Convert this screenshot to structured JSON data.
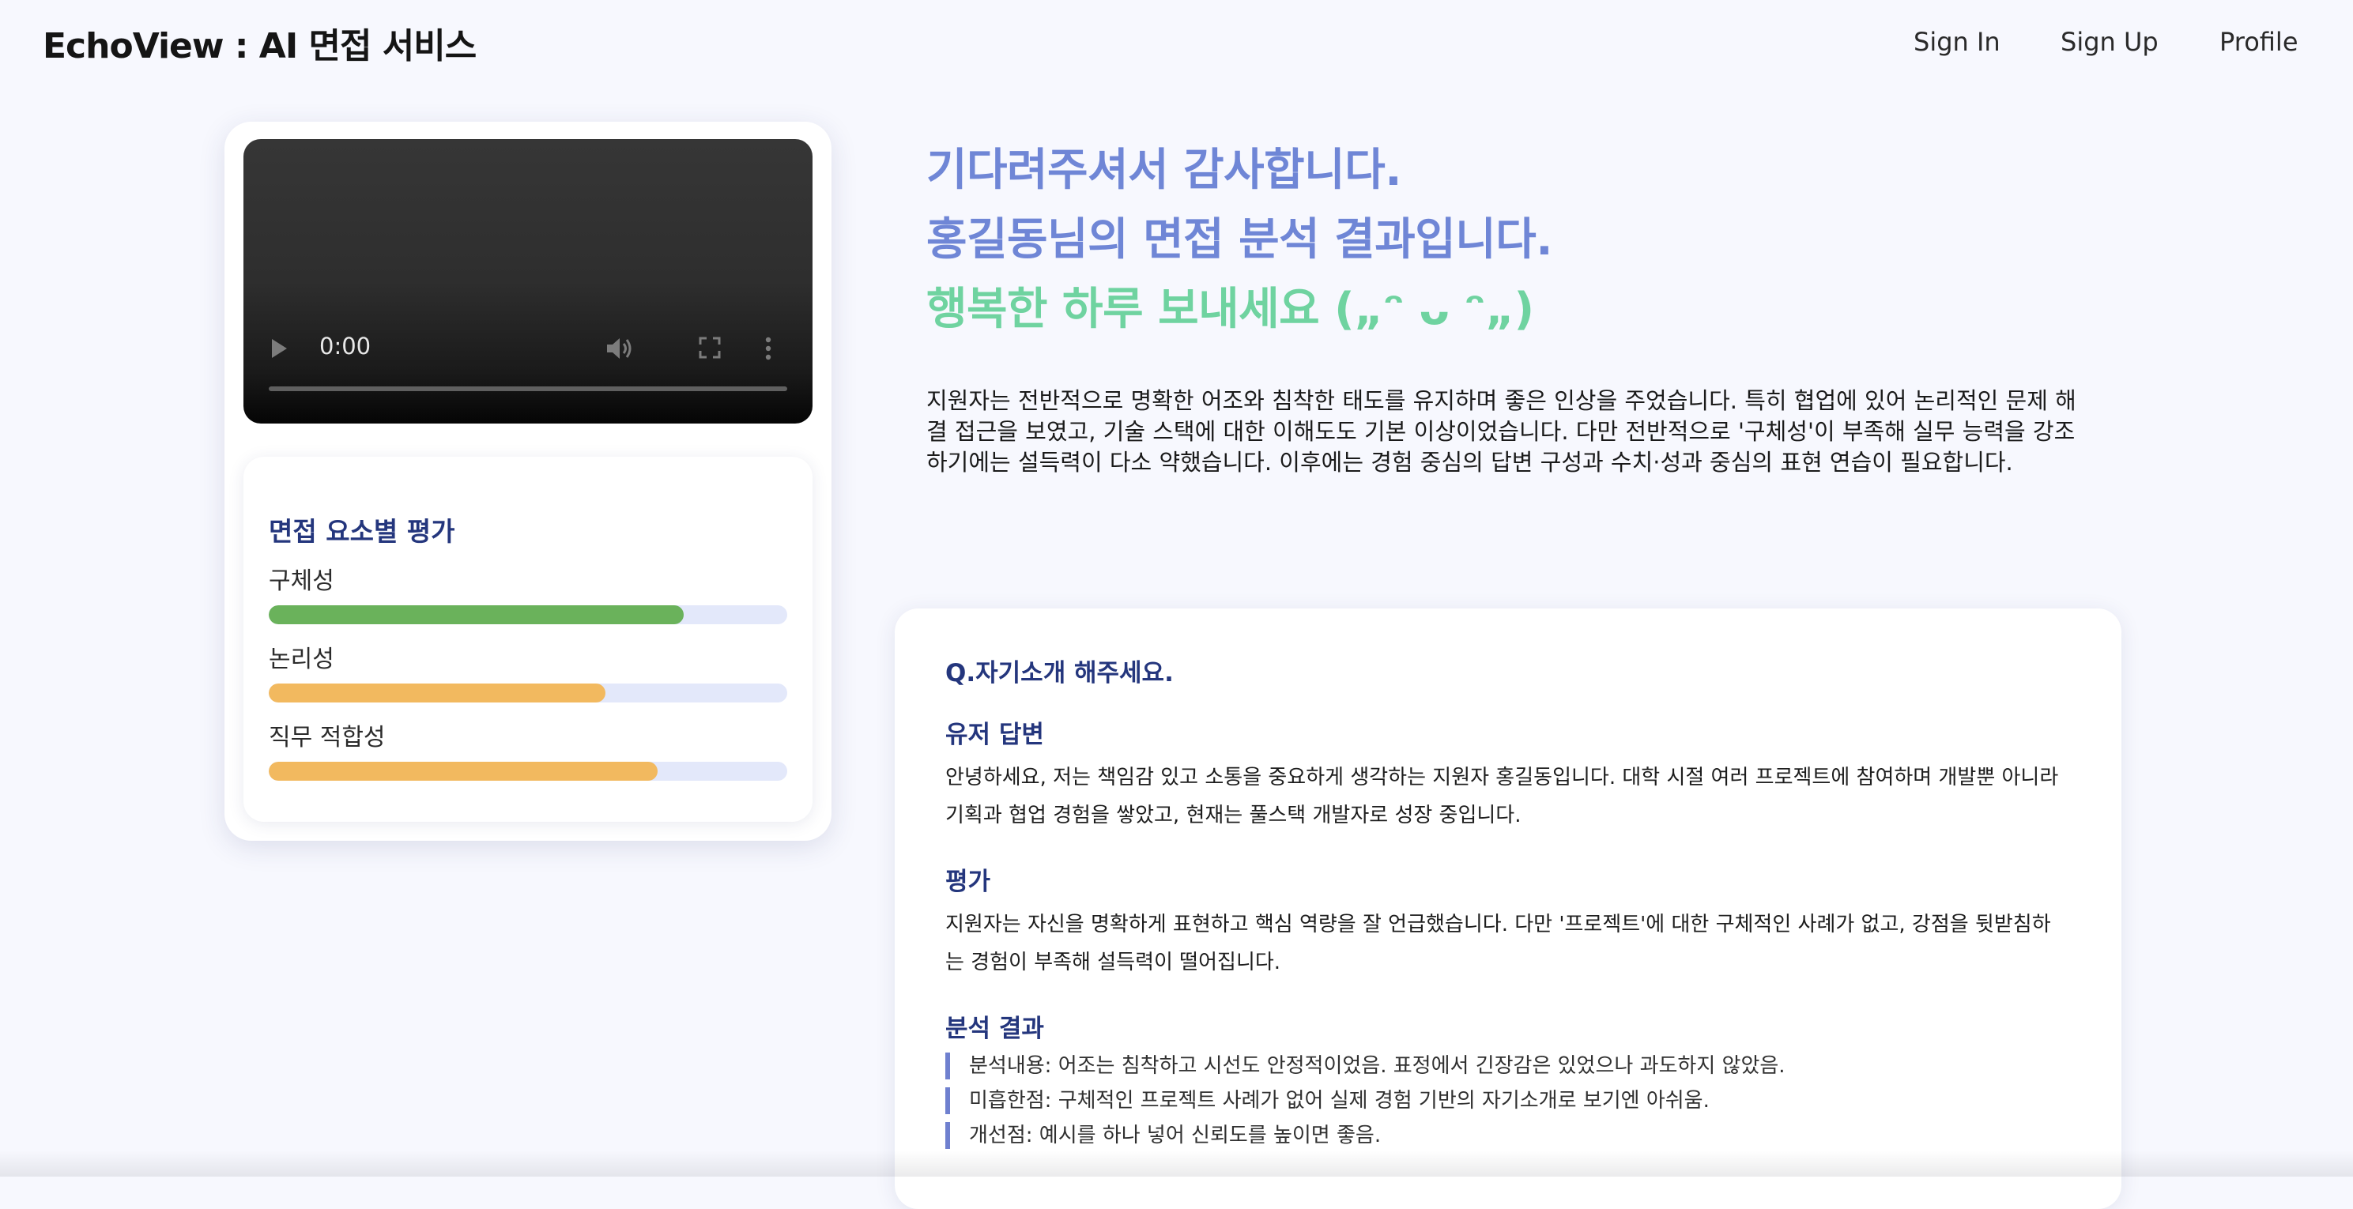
{
  "header": {
    "brand": "EchoView : AI 면접 서비스",
    "nav": {
      "sign_in": "Sign In",
      "sign_up": "Sign Up",
      "profile": "Profile"
    }
  },
  "video": {
    "time": "0:00",
    "icons": [
      "play-icon",
      "volume-icon",
      "fullscreen-icon",
      "more-vertical-icon"
    ]
  },
  "evaluation": {
    "title": "면접 요소별 평가",
    "metrics": [
      {
        "label": "구체성",
        "value": 0.8,
        "color": "#6ab25b"
      },
      {
        "label": "논리성",
        "value": 0.65,
        "color": "#f2b95f"
      },
      {
        "label": "직무 적합성",
        "value": 0.75,
        "color": "#f2b95f"
      }
    ]
  },
  "headline": {
    "line1": "기다려주셔서 감사합니다.",
    "line2": "홍길동님의 면접 분석 결과입니다.",
    "line3": "행복한 하루 보내세요 („ᵔ ᴗ ᵔ„)",
    "color_primary": "#6f86d6",
    "color_secondary": "#6fd3a0"
  },
  "summary": "지원자는 전반적으로 명확한 어조와 침착한 태도를 유지하며 좋은 인상을 주었습니다. 특히 협업에 있어 논리적인 문제 해결 접근을 보였고, 기술 스택에 대한 이해도도 기본 이상이었습니다. 다만 전반적으로 '구체성'이 부족해 실무 능력을 강조하기에는 설득력이 다소 약했습니다. 이후에는 경험 중심의 답변 구성과 수치·성과 중심의 표현 연습이 필요합니다.",
  "qa": {
    "question": "Q.자기소개 해주세요.",
    "answer_title": "유저 답변",
    "answer": "안녕하세요, 저는 책임감 있고 소통을 중요하게 생각하는 지원자 홍길동입니다. 대학 시절 여러 프로젝트에 참여하며 개발뿐 아니라 기획과 협업 경험을 쌓았고, 현재는 풀스택 개발자로 성장 중입니다.",
    "evaluation_title": "평가",
    "evaluation": "지원자는 자신을 명확하게 표현하고 핵심 역량을 잘 언급했습니다. 다만 '프로젝트'에 대한 구체적인 사례가 없고, 강점을 뒷받침하는 경험이 부족해 설득력이 떨어집니다.",
    "analysis_title": "분석 결과",
    "analysis": [
      "분석내용: 어조는 침착하고 시선도 안정적이었음. 표정에서 긴장감은 있었으나 과도하지 않았음.",
      "미흡한점: 구체적인 프로젝트 사례가 없어 실제 경험 기반의 자기소개로 보기엔 아쉬움.",
      "개선점: 예시를 하나 넣어 신뢰도를 높이면 좋음."
    ]
  }
}
